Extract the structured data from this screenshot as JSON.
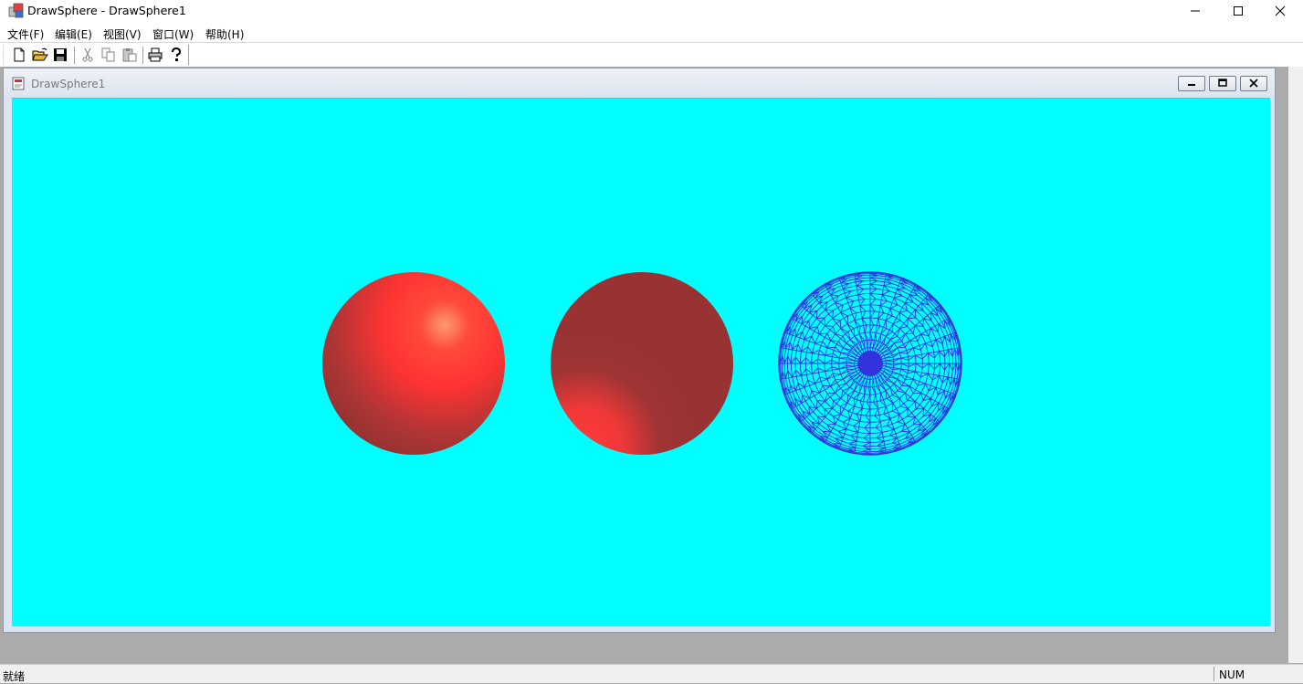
{
  "window": {
    "title": "DrawSphere - DrawSphere1"
  },
  "menu": {
    "items": [
      "文件(F)",
      "编辑(E)",
      "视图(V)",
      "窗口(W)",
      "帮助(H)"
    ]
  },
  "toolbar": {
    "buttons": [
      "new-icon",
      "open-icon",
      "save-icon",
      "cut-icon",
      "copy-icon",
      "paste-icon",
      "print-icon",
      "help-icon"
    ]
  },
  "child_window": {
    "title": "DrawSphere1"
  },
  "canvas": {
    "background": "#00ffff",
    "spheres": [
      {
        "name": "shaded-sphere-lit-top-right",
        "color": "#ff3333"
      },
      {
        "name": "shaded-sphere-lit-bottom-left",
        "color": "#993333"
      },
      {
        "name": "wireframe-sphere",
        "color": "#3333dd"
      }
    ]
  },
  "status": {
    "text": "就绪",
    "num": "NUM"
  }
}
